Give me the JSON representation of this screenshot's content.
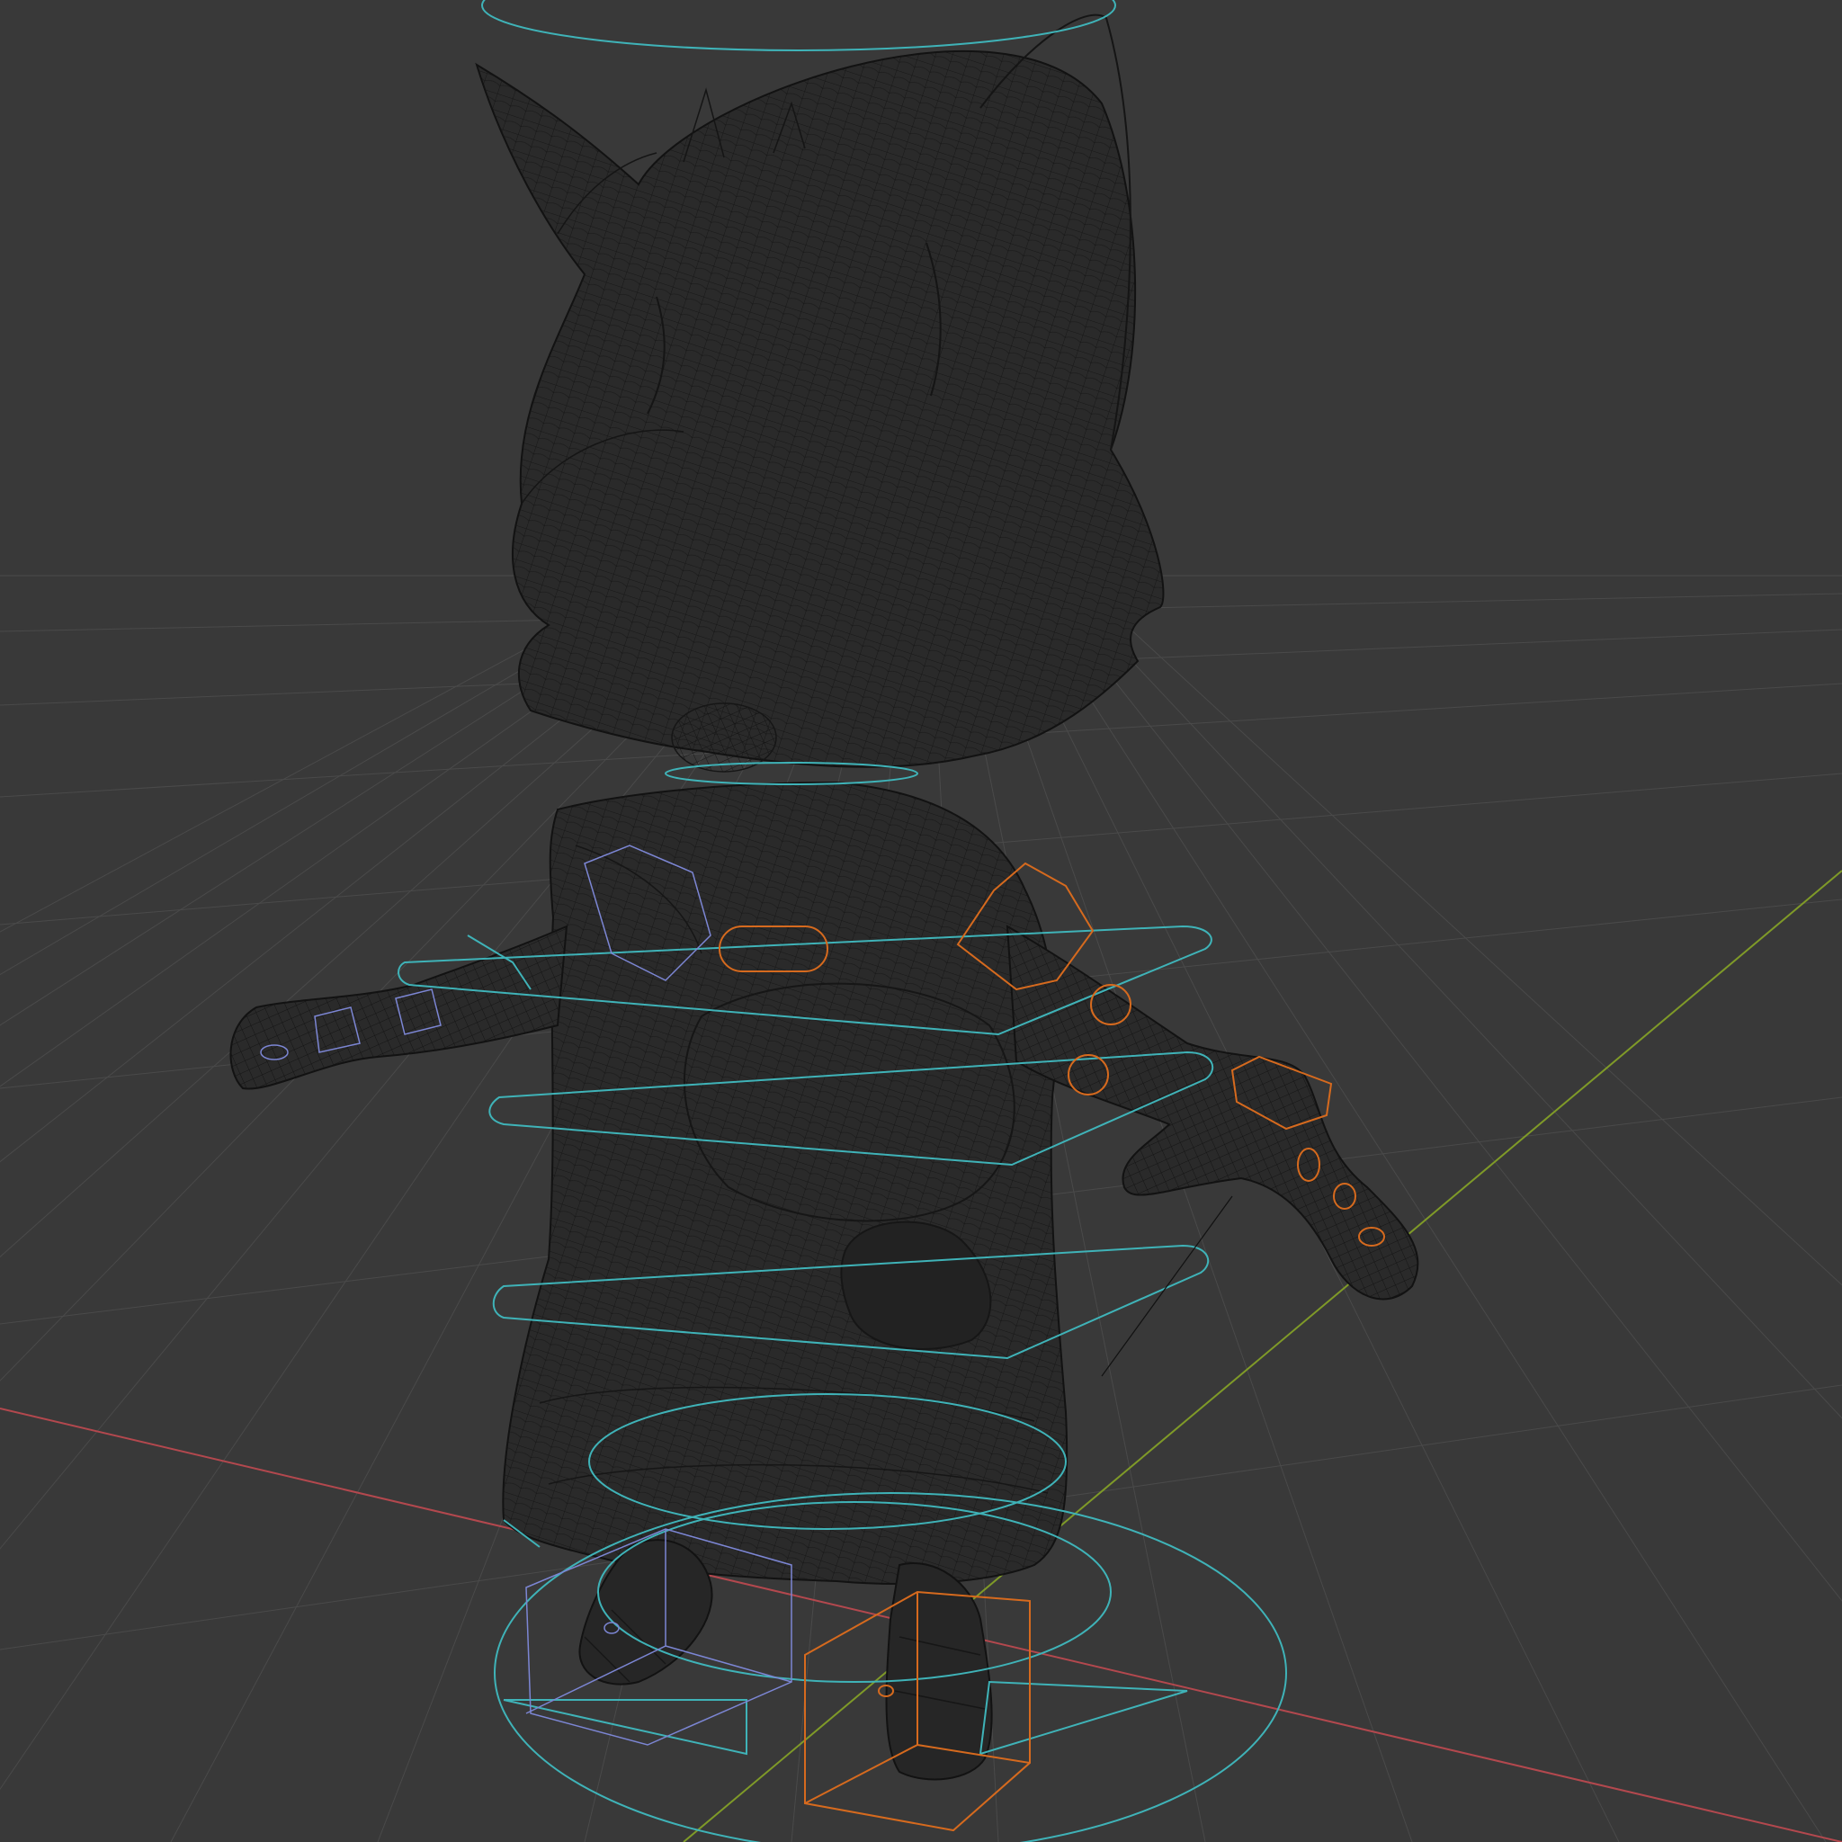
{
  "viewport": {
    "kind": "3d-viewport",
    "shading": "wireframe",
    "background_color": "#393939",
    "grid_color": "#4a4a4a",
    "axis_x_color": "#b3484e",
    "axis_y_color": "#7f9a28",
    "mesh_wire_color": "#121212",
    "controls_color_main": "#3fb3b8",
    "controls_color_left": "#7c86d4",
    "controls_color_right": "#d66a1e"
  },
  "scene": {
    "object": "cartoon-character-mesh",
    "rig": "armature-control-shapes"
  }
}
